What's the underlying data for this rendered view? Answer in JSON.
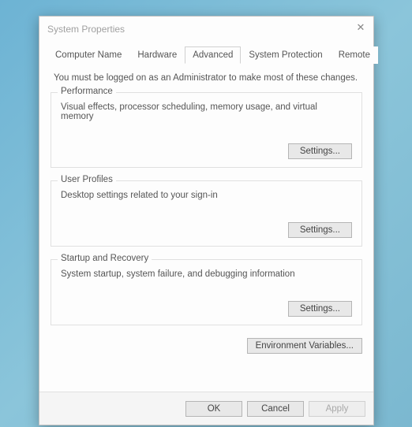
{
  "window": {
    "title": "System Properties"
  },
  "tabs": {
    "computer_name": "Computer Name",
    "hardware": "Hardware",
    "advanced": "Advanced",
    "system_protection": "System Protection",
    "remote": "Remote"
  },
  "instruction": "You must be logged on as an Administrator to make most of these changes.",
  "performance": {
    "legend": "Performance",
    "desc": "Visual effects, processor scheduling, memory usage, and virtual memory",
    "settings_btn": "Settings..."
  },
  "user_profiles": {
    "legend": "User Profiles",
    "desc": "Desktop settings related to your sign-in",
    "settings_btn": "Settings..."
  },
  "startup": {
    "legend": "Startup and Recovery",
    "desc": "System startup, system failure, and debugging information",
    "settings_btn": "Settings..."
  },
  "env_vars_btn": "Environment Variables...",
  "dialog": {
    "ok": "OK",
    "cancel": "Cancel",
    "apply": "Apply"
  }
}
